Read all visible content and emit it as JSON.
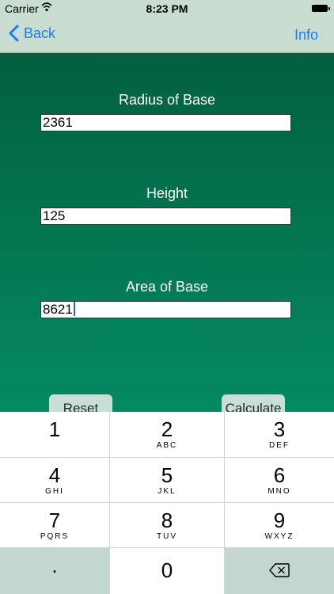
{
  "status": {
    "carrier": "Carrier",
    "time": "8:23 PM"
  },
  "nav": {
    "back_label": "Back",
    "info_label": "Info"
  },
  "form": {
    "radius": {
      "label": "Radius of Base",
      "value": "2361"
    },
    "height": {
      "label": "Height",
      "value": "125"
    },
    "area": {
      "label": "Area of Base",
      "value": "8621"
    }
  },
  "buttons": {
    "reset": "Reset",
    "calculate": "Calculate"
  },
  "keypad": {
    "k1": {
      "num": "1",
      "letters": ""
    },
    "k2": {
      "num": "2",
      "letters": "ABC"
    },
    "k3": {
      "num": "3",
      "letters": "DEF"
    },
    "k4": {
      "num": "4",
      "letters": "GHI"
    },
    "k5": {
      "num": "5",
      "letters": "JKL"
    },
    "k6": {
      "num": "6",
      "letters": "MNO"
    },
    "k7": {
      "num": "7",
      "letters": "PQRS"
    },
    "k8": {
      "num": "8",
      "letters": "TUV"
    },
    "k9": {
      "num": "9",
      "letters": "WXYZ"
    },
    "dot": ".",
    "k0": "0"
  },
  "colors": {
    "accent": "#1b7cf2",
    "background_top": "#02603f",
    "background_bottom": "#048a63",
    "navbar": "#c9dcd0"
  },
  "icons": {
    "back": "chevron-left-icon",
    "wifi": "wifi-icon",
    "battery": "battery-icon",
    "delete": "backspace-icon"
  }
}
